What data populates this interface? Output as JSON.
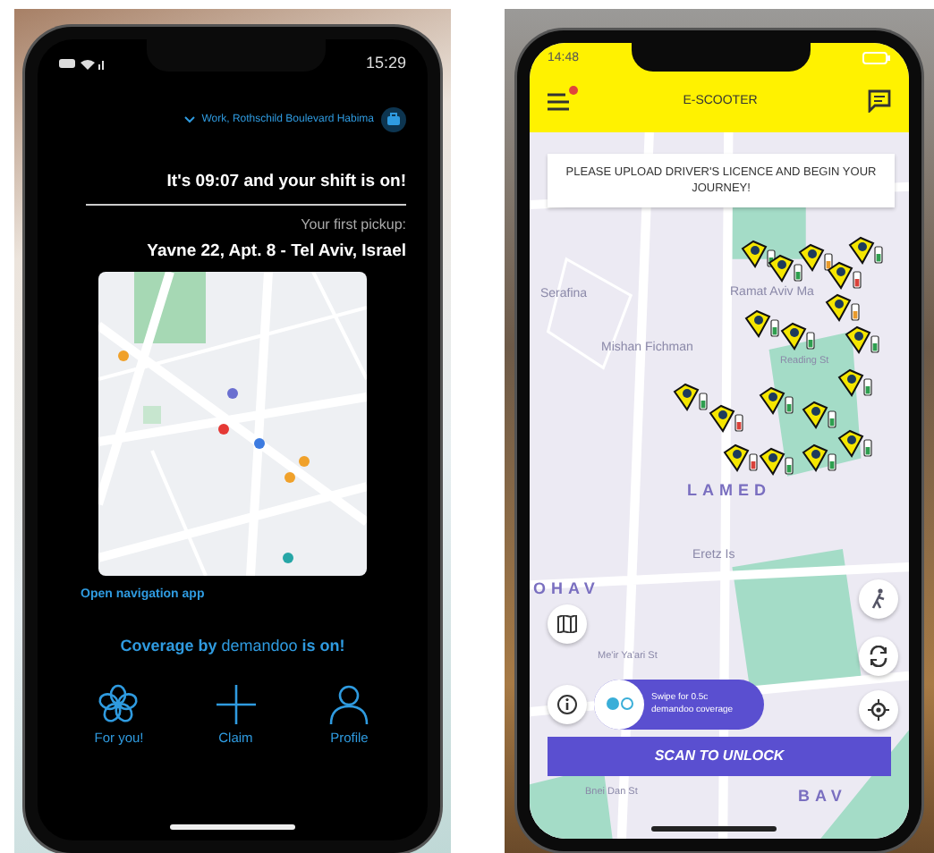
{
  "left_phone": {
    "status_bar": {
      "time": "15:29"
    },
    "location": {
      "label": "Work, Rothschild Boulevard Habima"
    },
    "heading": "It's 09:07 and your shift is on!",
    "pickup_label": "Your first pickup:",
    "pickup_address": "Yavne 22, Apt. 8 - Tel Aviv, Israel",
    "navigation_link": "Open navigation app",
    "coverage": "Coverage by **demandoo** is on!",
    "nav_items": [
      {
        "kind": "flower",
        "label": "For you!",
        "selected": false
      },
      {
        "kind": "plus",
        "label": "Claim",
        "selected": false
      },
      {
        "kind": "person",
        "label": "Profile",
        "selected": false
      }
    ]
  },
  "right_phone": {
    "status_bar": {
      "time": "14:48"
    },
    "header": {
      "title": "E-SCOOTER",
      "menu_badge": true
    },
    "banner": "PLEASE UPLOAD DRIVER'S LICENCE AND BEGIN YOUR JOURNEY!",
    "map_labels": [
      {
        "text": "Serafina",
        "kind": "place"
      },
      {
        "text": "Ramat Aviv Ma",
        "kind": "place"
      },
      {
        "text": "Mishan Fichman",
        "kind": "place"
      },
      {
        "text": "Reading St",
        "kind": "street"
      },
      {
        "text": "LAMED",
        "kind": "district"
      },
      {
        "text": "Eretz Is",
        "kind": "place"
      },
      {
        "text": "OHAV",
        "kind": "district"
      },
      {
        "text": "Me'ir Ya'ari St",
        "kind": "street"
      },
      {
        "text": "Bnei Dan St",
        "kind": "street"
      },
      {
        "text": "BAV",
        "kind": "district"
      }
    ],
    "scooters": [
      {
        "color": "#2e9e4f"
      },
      {
        "color": "#2e9e4f"
      },
      {
        "color": "#e89a2b"
      },
      {
        "color": "#d9413a"
      },
      {
        "color": "#2e9e4f"
      },
      {
        "color": "#2e9e4f"
      },
      {
        "color": "#2e9e4f"
      },
      {
        "color": "#e89a2b"
      },
      {
        "color": "#2e9e4f"
      },
      {
        "color": "#2e9e4f"
      },
      {
        "color": "#d9413a"
      },
      {
        "color": "#2e9e4f"
      },
      {
        "color": "#2e9e4f"
      },
      {
        "color": "#2e9e4f"
      },
      {
        "color": "#d9413a"
      },
      {
        "color": "#2e9e4f"
      },
      {
        "color": "#2e9e4f"
      },
      {
        "color": "#2e9e4f"
      }
    ],
    "coverage_toggle": {
      "label": "Swipe for 0.5c demandoo coverage",
      "on": false
    },
    "scan_button": "SCAN TO UNLOCK"
  }
}
